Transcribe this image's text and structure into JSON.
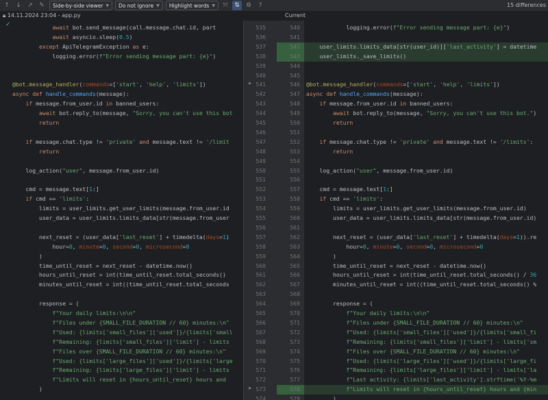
{
  "toolbar": {
    "prev_label": "↑",
    "next_label": "↓",
    "jump_label": "↗",
    "edit_label": "✎",
    "viewer_mode": "Side-by-side viewer",
    "ignore_mode": "Do not ignore",
    "highlight_mode": "Highlight words",
    "differences": "15 differences"
  },
  "header": {
    "left_title": "14.11.2024 23:04 - app.py",
    "right_title": "Current"
  },
  "left_lines": [
    "            await bot.send_message(call.message.chat.id, part",
    "            await asyncio.sleep(0.5)",
    "        except ApiTelegramException as e:",
    "            logging.error(f\"Error sending message part: {e}\")",
    "",
    "",
    "@bot.message_handler(commands=['start', 'help', 'limits'])",
    "async def handle_commands(message):",
    "    if message.from_user.id in banned_users:",
    "        await bot.reply_to(message, \"Sorry, you can't use this bot",
    "        return",
    "",
    "    if message.chat.type != 'private' and message.text != '/limit",
    "        return",
    "",
    "    log_action(\"user\", message.from_user.id)",
    "",
    "    cmd = message.text[1:]",
    "    if cmd == 'limits':",
    "        limits = user_limits.get_user_limits(message.from_user.id",
    "        user_data = user_limits.limits_data[str(message.from_user",
    "",
    "        next_reset = (user_data['last_reset'] + timedelta(days=1)",
    "            hour=0, minute=0, second=0, microsecond=0",
    "        )",
    "        time_until_reset = next_reset - datetime.now()",
    "        hours_until_reset = int(time_until_reset.total_seconds()",
    "        minutes_until_reset = int((time_until_reset.total_seconds",
    "",
    "        response = (",
    "            f\"Your daily limits:\\n\\n\"",
    "            f\"Files under {SMALL_FILE_DURATION // 60} minutes:\\n\"",
    "            f\"Used: {limits['small_files']['used']}/{limits['small",
    "            f\"Remaining: {limits['small_files']['limit'] - limits",
    "            f\"Files over {SMALL_FILE_DURATION // 60} minutes:\\n\"",
    "            f\"Used: {limits['large_files']['used']}/{limits['large",
    "            f\"Remaining: {limits['large_files']['limit'] - limits",
    "            f\"Limits will reset in {hours_until_reset} hours and",
    "        )",
    ""
  ],
  "right_lines": [
    "            logging.error(f\"Error sending message part: {e}\")",
    "",
    "    user_limits.limits_data[str(user_id)]['last_activity'] = datetime",
    "    user_limits._save_limits()",
    "",
    "",
    "@bot.message_handler(commands=['start', 'help', 'limits'])",
    "async def handle_commands(message):",
    "    if message.from_user.id in banned_users:",
    "        await bot.reply_to(message, \"Sorry, you can't use this bot.\")",
    "        return",
    "",
    "    if message.chat.type != 'private' and message.text != '/limits':",
    "        return",
    "",
    "    log_action(\"user\", message.from_user.id)",
    "",
    "    cmd = message.text[1:]",
    "    if cmd == 'limits':",
    "        limits = user_limits.get_user_limits(message.from_user.id)",
    "        user_data = user_limits.limits_data[str(message.from_user.id)",
    "",
    "        next_reset = (user_data['last_reset'] + timedelta(days=1)).re",
    "            hour=0, minute=0, second=0, microsecond=0",
    "        )",
    "        time_until_reset = next_reset - datetime.now()",
    "        hours_until_reset = int(time_until_reset.total_seconds() / 36",
    "        minutes_until_reset = int((time_until_reset.total_seconds() %",
    "",
    "        response = (",
    "            f\"Your daily limits:\\n\\n\"",
    "            f\"Files under {SMALL_FILE_DURATION // 60} minutes:\\n\"",
    "            f\"Used: {limits['small_files']['used']}/{limits['small_fi",
    "            f\"Remaining: {limits['small_files']['limit'] - limits['sm",
    "            f\"Files over {SMALL_FILE_DURATION // 60} minutes:\\n\"",
    "            f\"Used: {limits['large_files']['used']}/{limits['large_fi",
    "            f\"Remaining: {limits['large_files']['limit'] - limits['la",
    "            f\"Last activity: {limits['last_activity'].strftime('%Y-%m",
    "            f\"Limits will reset in {hours_until_reset} hours and {min",
    "        )"
  ],
  "left_numbers": [
    "535",
    "536",
    "537",
    "538",
    "539",
    "540",
    "541",
    "542",
    "543",
    "544",
    "545",
    "546",
    "547",
    "548",
    "549",
    "550",
    "551",
    "552",
    "553",
    "554",
    "555",
    "556",
    "557",
    "558",
    "559",
    "560",
    "561",
    "562",
    "563",
    "564",
    "565",
    "566",
    "567",
    "568",
    "569",
    "570",
    "571",
    "572",
    "573",
    "574"
  ],
  "right_numbers": [
    "540",
    "541",
    "542",
    "543",
    "544",
    "545",
    "546",
    "547",
    "548",
    "549",
    "550",
    "551",
    "552",
    "553",
    "554",
    "555",
    "556",
    "557",
    "558",
    "559",
    "560",
    "561",
    "562",
    "563",
    "564",
    "565",
    "566",
    "567",
    "568",
    "569",
    "570",
    "571",
    "572",
    "573",
    "574",
    "575",
    "576",
    "577",
    "578",
    "579"
  ],
  "left_gutter_numbers": [
    "535",
    "536",
    "537",
    "538",
    "539",
    "540",
    "541",
    "542",
    "543",
    "544",
    "545",
    "546",
    "547",
    "548",
    "549",
    "550",
    "551",
    "552",
    "553",
    "554",
    "555",
    "556",
    "557",
    "558",
    "559",
    "560",
    "561",
    "562",
    "563",
    "564",
    "565",
    "566",
    "567",
    "568",
    "569",
    "570",
    "571",
    "572",
    "573",
    "574"
  ],
  "right_gutter_numbers": [
    "540",
    "541",
    "542",
    "543",
    "544",
    "545",
    "546",
    "547",
    "548",
    "549",
    "550",
    "551",
    "552",
    "553",
    "554",
    "555",
    "556",
    "557",
    "558",
    "559",
    "560",
    "561",
    "562",
    "563",
    "564",
    "565",
    "566",
    "567",
    "568",
    "569",
    "570",
    "571",
    "572",
    "573",
    "574",
    "575",
    "576",
    "577",
    "578",
    "579"
  ],
  "transfer_arrow": "»",
  "colors": {
    "added_bg": "#2a3b30",
    "added_gutter": "#37613e",
    "bg": "#1e1f22"
  }
}
